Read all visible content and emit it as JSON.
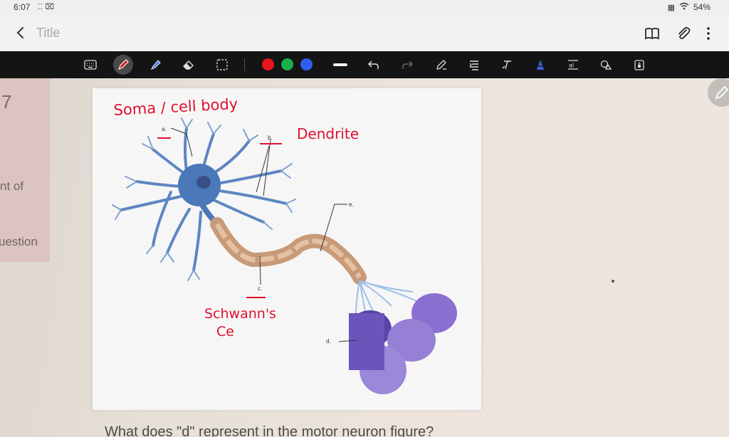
{
  "status_bar": {
    "time": "6:07",
    "notification_icons": "⁚⁚ ⌧",
    "battery": "54%"
  },
  "title_bar": {
    "title": "Title"
  },
  "toolbar": {
    "tools": [
      "keyboard-icon",
      "pen-icon",
      "highlighter-icon",
      "eraser-icon",
      "lasso-select-icon",
      "stroke-width-icon",
      "undo-icon",
      "redo-icon",
      "pen-edit-icon",
      "text-align-icon",
      "text-tool-icon",
      "ai-icon",
      "text-recognition-icon",
      "shapes-icon",
      "lock-icon"
    ],
    "colors": {
      "red": "#e8141c",
      "green": "#19b04a",
      "blue": "#2f5ef0"
    }
  },
  "document": {
    "left_strip": {
      "number": "7",
      "line1": "nt of",
      "line2": "uestion"
    },
    "question": "What does \"d\" represent in the motor neuron figure?",
    "figure_labels": {
      "a": "a.",
      "b": "b.",
      "c": "c.",
      "d": "d.",
      "e": "e."
    },
    "annotations": {
      "soma": "Soma / cell body",
      "dendrite": "Dendrite",
      "schwann_line1": "Schwann's",
      "schwann_line2": "Ce"
    }
  },
  "colors": {
    "ink": "#e01030",
    "toolbar_bg": "#141414",
    "neuron_body": "#4a78b8",
    "axon": "#c99a78",
    "muscle": "#7a5cc8"
  }
}
